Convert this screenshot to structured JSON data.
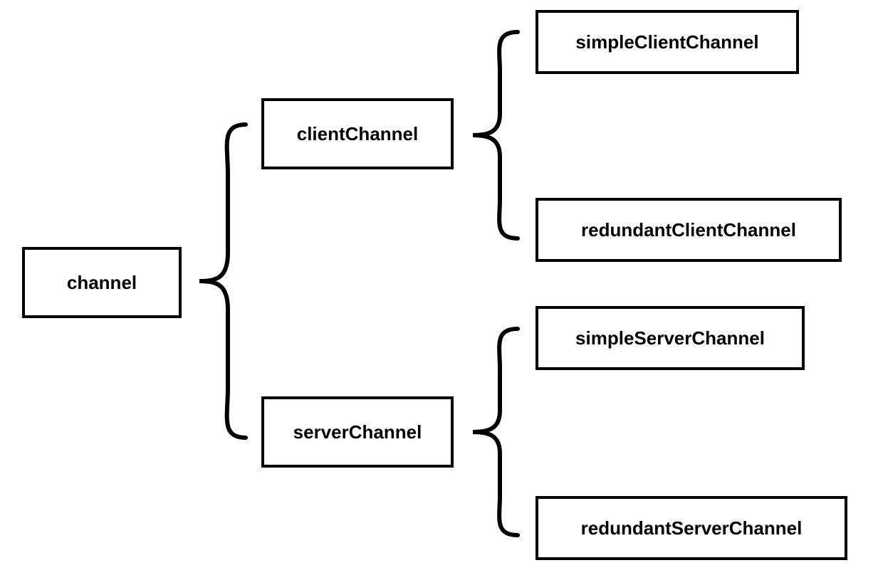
{
  "diagram": {
    "root": "channel",
    "level2": {
      "client": "clientChannel",
      "server": "serverChannel"
    },
    "level3": {
      "simpleClient": "simpleClientChannel",
      "redundantClient": "redundantClientChannel",
      "simpleServer": "simpleServerChannel",
      "redundantServer": "redundantServerChannel"
    }
  }
}
